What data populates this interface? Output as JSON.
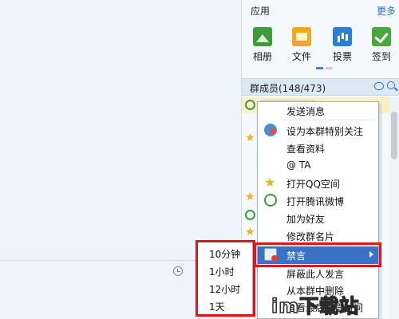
{
  "apps": {
    "title": "应用",
    "more": "更多",
    "items": [
      {
        "label": "相册",
        "icon": "photo-album-icon"
      },
      {
        "label": "文件",
        "icon": "folder-icon"
      },
      {
        "label": "投票",
        "icon": "vote-chart-icon"
      },
      {
        "label": "签到",
        "icon": "checkin-check-icon"
      }
    ]
  },
  "members": {
    "title": "群成员(148/473)"
  },
  "context_menu": {
    "items": [
      {
        "label": "发送消息"
      },
      {
        "label": "设为本群特别关注",
        "icon": "special-follow-icon"
      },
      {
        "label": "查看资料"
      },
      {
        "label": "@ TA"
      },
      {
        "label": "打开QQ空间",
        "icon": "qzone-star-icon"
      },
      {
        "label": "打开腾讯微博",
        "icon": "tencent-weibo-icon"
      },
      {
        "label": "加为好友"
      },
      {
        "label": "修改群名片"
      },
      {
        "label": "禁言",
        "icon": "mute-icon",
        "has_submenu": true
      },
      {
        "label": "屏蔽此人发言"
      },
      {
        "label": "从本群中删除"
      },
      {
        "label": "查看最后发言时间"
      }
    ]
  },
  "sub_menu": {
    "items": [
      {
        "label": "10分钟"
      },
      {
        "label": "1小时"
      },
      {
        "label": "12小时"
      },
      {
        "label": "1天"
      }
    ]
  },
  "watermark": {
    "text": "im下载站"
  },
  "colors": {
    "accent": "#3a72c6",
    "annotation_red": "#e0141b",
    "panel_bg": "#f4f9fd",
    "chat_bg": "#eef4fb"
  }
}
